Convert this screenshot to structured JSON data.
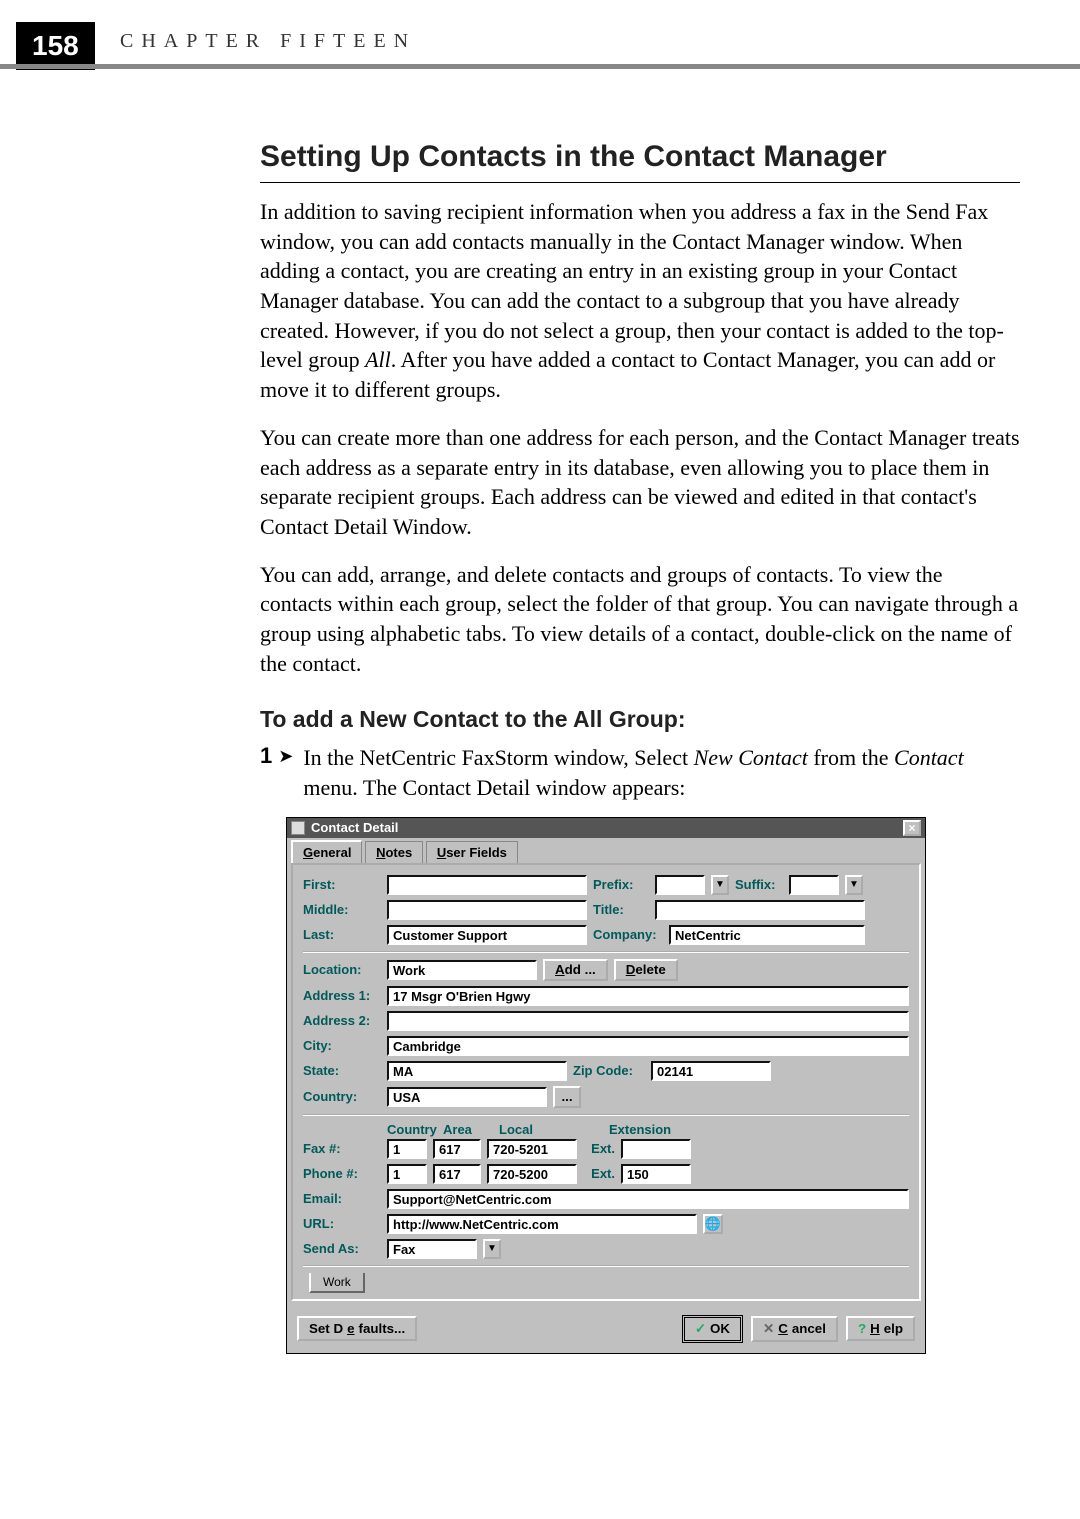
{
  "page_number": "158",
  "chapter_label": "CHAPTER FIFTEEN",
  "section_title": "Setting Up Contacts in the Contact Manager",
  "para1_a": "In addition to saving recipient information when you address a fax in the Send Fax window, you can add contacts manually in the Contact Manager window. When adding a contact, you are creating an entry in an existing group in your Contact Manager database. You can add the contact to a subgroup that you have already created. However, if you do not select a group, then your contact is added to the top-level group ",
  "para1_em": "All",
  "para1_b": ". After you have added a contact to Contact Manager, you can add or move it to different groups.",
  "para2": "You can create more than one address for each person, and the Contact Manager treats each address as a separate entry in its database, even allowing you to place them in separate recipient groups. Each address can be viewed and edited in that contact's Contact Detail Window.",
  "para3": "You can add, arrange, and delete contacts and groups of contacts. To view the contacts within each group, select the folder of that group. You can navigate through a group using alphabetic tabs. To view details of a contact, double-click on the name of the contact.",
  "subhead": "To add a New Contact to the All Group:",
  "step1": {
    "num": "1",
    "text_a": "In the NetCentric FaxStorm window, Select ",
    "em1": "New Contact",
    "text_b": "  from the ",
    "em2": "Contact",
    "text_c": " menu. The Contact Detail window appears:"
  },
  "dialog": {
    "title": "Contact Detail",
    "tabs": {
      "general": "General",
      "notes": "Notes",
      "user_fields": "User Fields"
    },
    "labels": {
      "first": "First:",
      "middle": "Middle:",
      "last": "Last:",
      "prefix": "Prefix:",
      "title": "Title:",
      "company": "Company:",
      "suffix": "Suffix:",
      "location": "Location:",
      "address1": "Address 1:",
      "address2": "Address 2:",
      "city": "City:",
      "state": "State:",
      "zip": "Zip Code:",
      "country": "Country:",
      "fax": "Fax #:",
      "phone": "Phone #:",
      "email": "Email:",
      "url": "URL:",
      "send_as": "Send As:",
      "ext": "Ext.",
      "col_country": "Country",
      "col_area": "Area",
      "col_local": "Local",
      "col_ext": "Extension"
    },
    "values": {
      "first": "",
      "middle": "",
      "last": "Customer Support",
      "prefix": "",
      "title": "",
      "company": "NetCentric",
      "suffix": "",
      "location": "Work",
      "address1": "17 Msgr O'Brien Hgwy",
      "address2": "",
      "city": "Cambridge",
      "state": "MA",
      "zip": "02141",
      "country": "USA",
      "fax_country": "1",
      "fax_area": "617",
      "fax_local": "720-5201",
      "fax_ext": "",
      "phone_country": "1",
      "phone_area": "617",
      "phone_local": "720-5200",
      "phone_ext": "150",
      "email": "Support@NetCentric.com",
      "url": "http://www.NetCentric.com",
      "send_as": "Fax"
    },
    "buttons": {
      "add": "Add ...",
      "delete": "Delete",
      "ellipsis": "...",
      "set_defaults": "Set Defaults...",
      "ok": "OK",
      "cancel": "Cancel",
      "help": "Help"
    },
    "bottom_tab": "Work"
  }
}
